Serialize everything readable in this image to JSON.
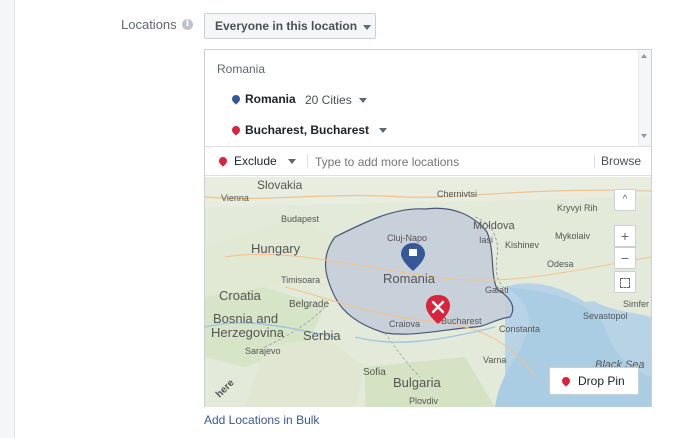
{
  "locations": {
    "label": "Locations",
    "info_icon": "i",
    "audience_select": "Everyone in this location"
  },
  "selected": {
    "country": "Romania",
    "included": {
      "name": "Romania",
      "radius": "20 Cities"
    },
    "excluded": {
      "name": "Bucharest, Bucharest"
    }
  },
  "exclude_bar": {
    "mode": "Exclude",
    "placeholder": "Type to add more locations",
    "browse": "Browse"
  },
  "map": {
    "labels": {
      "slovakia": "Slovakia",
      "vienna": "Vienna",
      "budapest": "Budapest",
      "hungary": "Hungary",
      "chernivtsi": "Chernivtsi",
      "kryvyi_rih": "Kryvyi Rih",
      "moldova": "Moldova",
      "iasi": "Iasi",
      "kishinev": "Kishinev",
      "mykolaiv": "Mykolaiv",
      "cluj": "Cluj-Napo",
      "odesa": "Odesa",
      "timisoara": "Timisoara",
      "romania": "Romania",
      "croatia": "Croatia",
      "belgrade": "Belgrade",
      "galati": "Galati",
      "simfer": "Simfer",
      "bosnia": "Bosnia and",
      "herzegovina": "Herzegovina",
      "serbia": "Serbia",
      "craiova": "Craiova",
      "bucharest": "Bucharest",
      "constanta": "Constanta",
      "sevastopol": "Sevastopol",
      "sarajevo": "Sarajevo",
      "varna": "Varna",
      "black_sea": "Black Sea",
      "sofia": "Sofia",
      "bulgaria": "Bulgaria",
      "plovdiv": "Plovdiv",
      "here": "here"
    },
    "controls": {
      "up": "^",
      "zoom_in": "+",
      "zoom_out": "−"
    },
    "drop_pin": "Drop Pin"
  },
  "bulk_link": "Add Locations in Bulk",
  "colors": {
    "link": "#385898",
    "include_pin": "#365899",
    "exclude_pin": "#d8243c"
  }
}
